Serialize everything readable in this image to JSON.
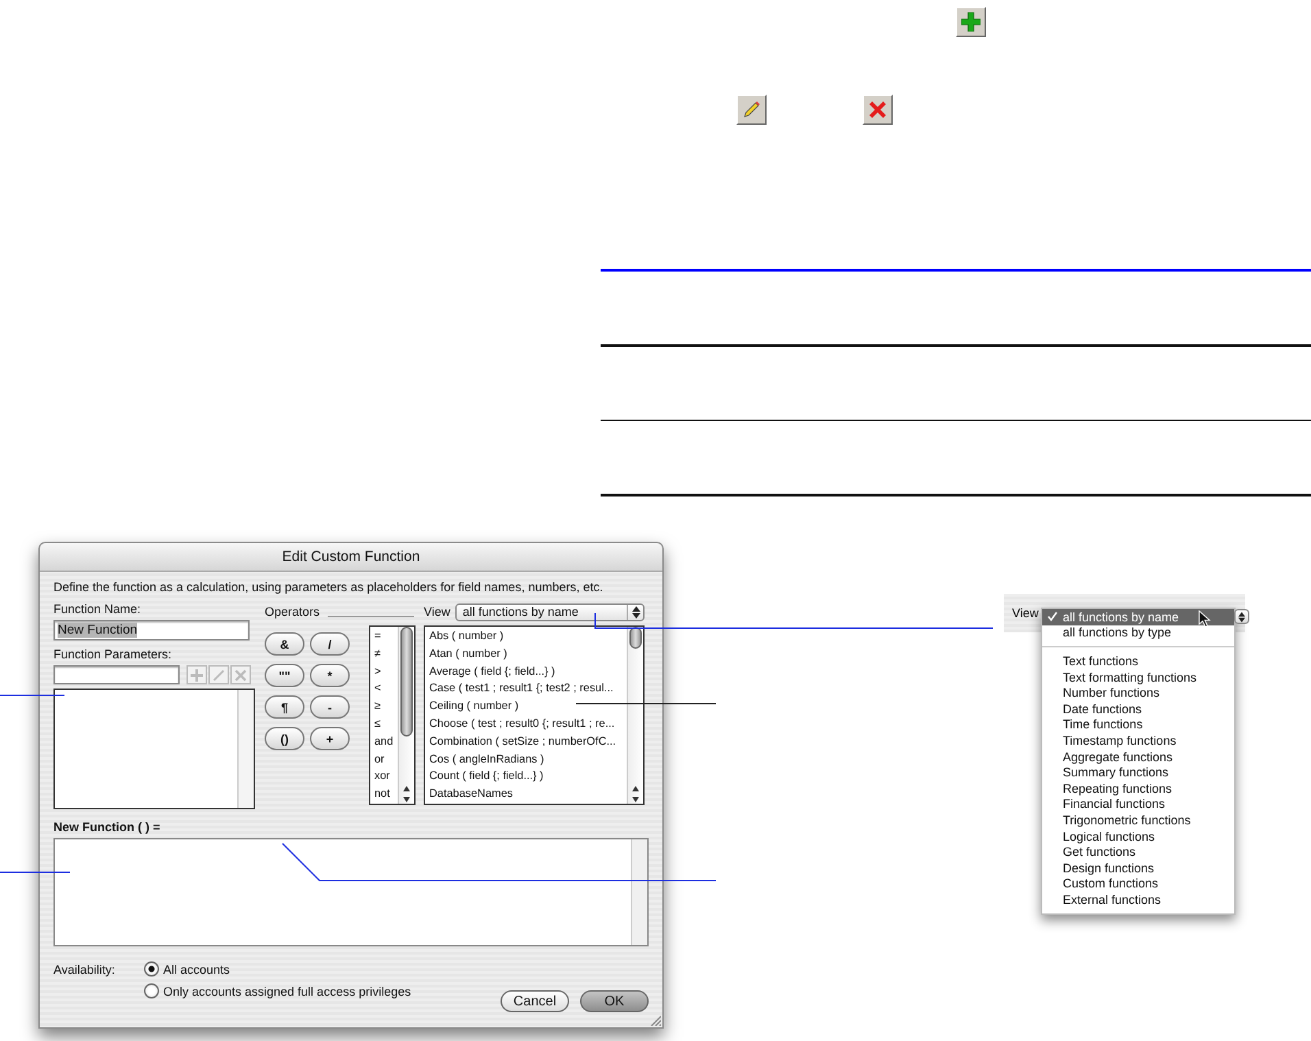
{
  "dialog": {
    "title": "Edit Custom Function",
    "description": "Define the function as a calculation, using parameters as placeholders for field names, numbers, etc.",
    "function_name_label": "Function Name:",
    "function_name_value": "New Function",
    "function_parameters_label": "Function Parameters:",
    "operators_label": "Operators",
    "operator_buttons": [
      "&",
      "/",
      "\"\"",
      "*",
      "¶",
      "-",
      "()",
      "+"
    ],
    "operator_list": [
      "=",
      "≠",
      ">",
      "<",
      "≥",
      "≤",
      "and",
      "or",
      "xor",
      "not"
    ],
    "view_label": "View",
    "view_value": "all functions by name",
    "functions": [
      "Abs ( number )",
      "Atan ( number )",
      "Average ( field {; field...} )",
      "Case ( test1 ; result1 {; test2 ; resul...",
      "Ceiling ( number )",
      "Choose ( test ; result0 {; result1 ; re...",
      "Combination ( setSize ; numberOfC...",
      "Cos ( angleInRadians )",
      "Count ( field {; field...} )",
      "DatabaseNames"
    ],
    "formula_label": "New Function (  ) =",
    "availability_label": "Availability:",
    "availability_options": [
      {
        "label": "All accounts",
        "selected": true
      },
      {
        "label": "Only accounts assigned full access privileges",
        "selected": false
      }
    ],
    "buttons": [
      {
        "label": "Cancel",
        "default": false
      },
      {
        "label": "OK",
        "default": true
      }
    ]
  },
  "view_menu": {
    "view_label": "View",
    "groups": [
      [
        {
          "label": "all functions by name",
          "selected": true
        },
        {
          "label": "all functions by type",
          "selected": false
        }
      ],
      [
        {
          "label": "Text functions",
          "selected": false
        },
        {
          "label": "Text formatting functions",
          "selected": false
        },
        {
          "label": "Number functions",
          "selected": false
        },
        {
          "label": "Date functions",
          "selected": false
        },
        {
          "label": "Time functions",
          "selected": false
        },
        {
          "label": "Timestamp functions",
          "selected": false
        },
        {
          "label": "Aggregate functions",
          "selected": false
        },
        {
          "label": "Summary functions",
          "selected": false
        },
        {
          "label": "Repeating functions",
          "selected": false
        },
        {
          "label": "Financial functions",
          "selected": false
        },
        {
          "label": "Trigonometric functions",
          "selected": false
        },
        {
          "label": "Logical functions",
          "selected": false
        },
        {
          "label": "Get functions",
          "selected": false
        },
        {
          "label": "Design functions",
          "selected": false
        },
        {
          "label": "Custom functions",
          "selected": false
        },
        {
          "label": "External functions",
          "selected": false
        }
      ]
    ]
  }
}
